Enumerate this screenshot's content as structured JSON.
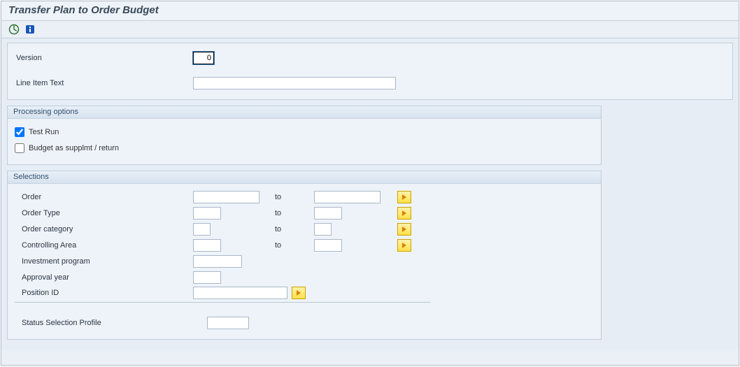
{
  "title": "Transfer Plan to Order Budget",
  "toolbar": {
    "execute_tooltip": "Execute",
    "info_tooltip": "Information"
  },
  "fields": {
    "version_label": "Version",
    "version_value": "0",
    "line_item_text_label": "Line Item Text",
    "line_item_text_value": ""
  },
  "groups": {
    "processing": {
      "title": "Processing options",
      "test_run_label": "Test Run",
      "test_run_checked": true,
      "budget_supp_label": "Budget as supplmt / return",
      "budget_supp_checked": false
    },
    "selections": {
      "title": "Selections",
      "to_label": "to",
      "order_label": "Order",
      "order_from": "",
      "order_to": "",
      "order_type_label": "Order Type",
      "order_type_from": "",
      "order_type_to": "",
      "order_cat_label": "Order category",
      "order_cat_from": "",
      "order_cat_to": "",
      "co_area_label": "Controlling Area",
      "co_area_from": "",
      "co_area_to": "",
      "inv_prog_label": "Investment program",
      "inv_prog_value": "",
      "approval_year_label": "Approval year",
      "approval_year_value": "",
      "position_id_label": "Position ID",
      "position_id_value": "",
      "status_profile_label": "Status Selection Profile",
      "status_profile_value": ""
    }
  }
}
